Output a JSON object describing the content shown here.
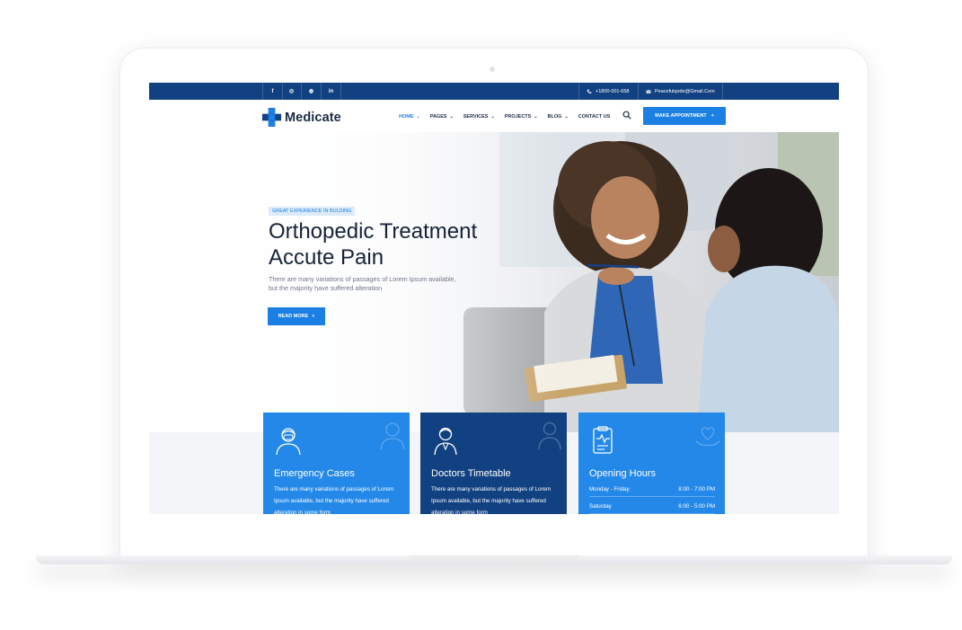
{
  "topbar": {
    "social": [
      "f",
      "◎",
      "◍",
      "in"
    ],
    "phone": "+1800-001-658",
    "email": "Peacefulqode@Gmail.Com"
  },
  "header": {
    "logo_text": "Medicate",
    "nav": [
      {
        "label": "HOME",
        "active": true
      },
      {
        "label": "PAGES",
        "active": false
      },
      {
        "label": "SERVICES",
        "active": false
      },
      {
        "label": "PROJECTS",
        "active": false
      },
      {
        "label": "BLOG",
        "active": false
      },
      {
        "label": "CONTACT US",
        "active": false
      }
    ],
    "appointment_label": "MAKE APPOINTMENT",
    "plus": "+"
  },
  "hero": {
    "badge": "GREAT EXPERIENCE IN BULDING",
    "title_line1": "Orthopedic Treatment",
    "title_line2": "Accute Pain",
    "text": "There are many variations of passages of Lorem Ipsum available, but the majority have suffered alteration",
    "read_more": "READ MORE",
    "plus": "+"
  },
  "cards": {
    "emergency": {
      "title": "Emergency Cases",
      "text": "There are many variations of passages of Lorem Ipsum available, but the majority have suffered alteration in some form"
    },
    "doctors": {
      "title": "Doctors Timetable",
      "text": "There are many variations of passages of Lorem Ipsum available, but the majority have suffered alteration in some form"
    },
    "hours": {
      "title": "Opening Hours",
      "rows": [
        {
          "day": "Monday - Friday",
          "time": "8:00 - 7:00 PM"
        },
        {
          "day": "Saturday",
          "time": "6:00 - 5:00 PM"
        }
      ]
    }
  },
  "colors": {
    "brand_dark": "#124181",
    "brand_blue": "#1b7fe3"
  }
}
